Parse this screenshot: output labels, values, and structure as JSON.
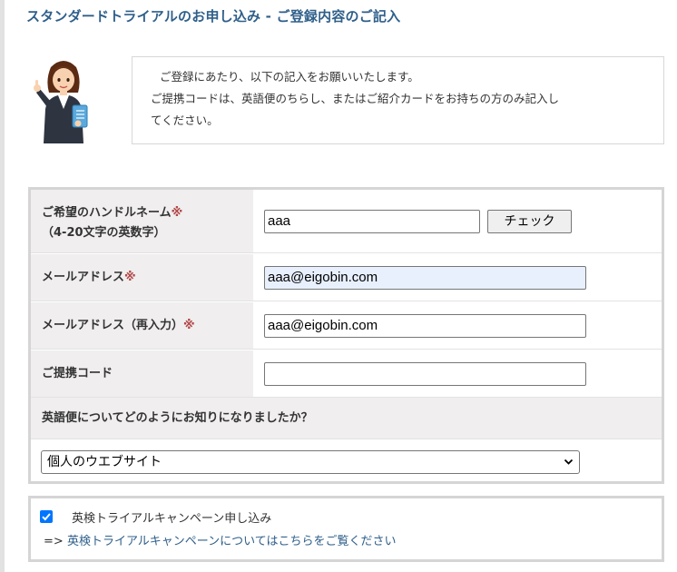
{
  "page_title": "スタンダードトライアルのお申し込み - ご登録内容のご記入",
  "intro": {
    "line1": "ご登録にあたり、以下の記入をお願いいたします。",
    "line2": "ご提携コードは、英語便のちらし、またはご紹介カードをお持ちの方のみ記入し",
    "line3": "てください。"
  },
  "form": {
    "handle": {
      "label": "ご希望のハンドルネーム",
      "required_mark": "※",
      "sublabel": "（4-20文字の英数字）",
      "value": "aaa",
      "check_button": "チェック"
    },
    "email": {
      "label": "メールアドレス",
      "required_mark": "※",
      "value": "aaa@eigobin.com"
    },
    "email_confirm": {
      "label": "メールアドレス（再入力）",
      "required_mark": "※",
      "value": "aaa@eigobin.com"
    },
    "partner_code": {
      "label": "ご提携コード",
      "value": ""
    },
    "source_question": {
      "label": "英語便についてどのようにお知りになりましたか？",
      "selected": "個人のウエブサイト"
    }
  },
  "campaign": {
    "checked": true,
    "label": "英検トライアルキャンペーン申し込み",
    "arrow": "=>",
    "link_text": "英検トライアルキャンペーンについてはこちらをご覧ください"
  },
  "colors": {
    "title": "#2f5f8a",
    "required": "#b24747",
    "link": "#2f5f8a",
    "label_bg": "#f0eeee",
    "autofill_bg": "#e8f0fe",
    "checkbox": "#0075ff"
  },
  "icons": {
    "mascot": "woman-pointing-illustration",
    "select_arrow": "chevron-down-icon",
    "checkbox": "check-icon"
  }
}
